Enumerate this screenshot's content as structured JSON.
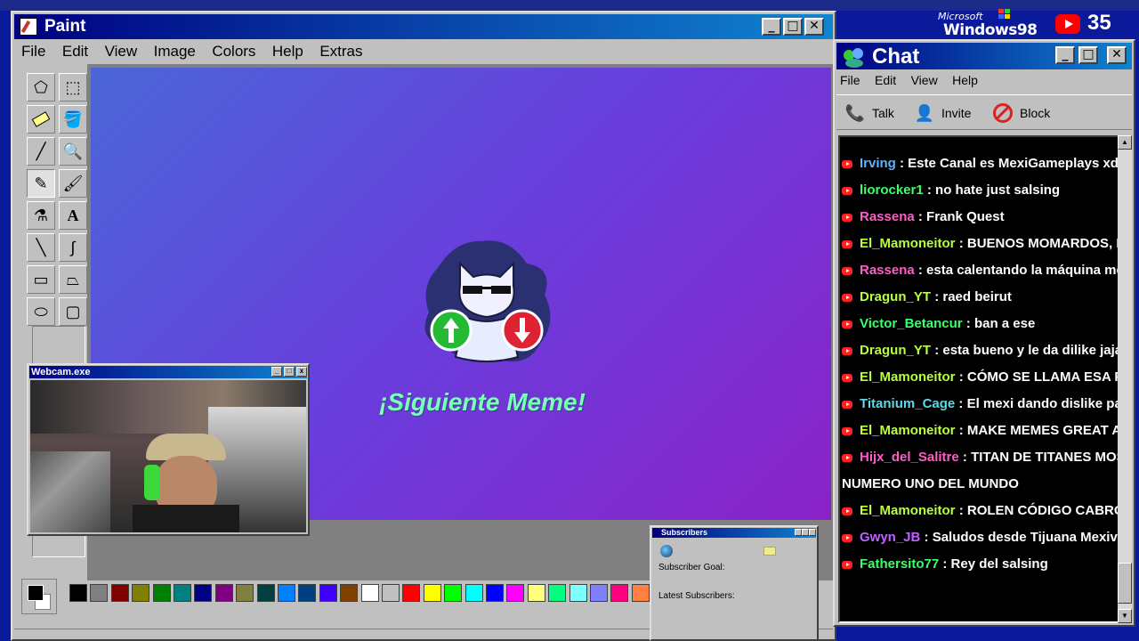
{
  "desktop": {
    "windows_badge_top": "Microsoft",
    "windows_badge_main": "Windows98",
    "youtube_count": "35"
  },
  "paint": {
    "title": "Paint",
    "menu": [
      "File",
      "Edit",
      "View",
      "Image",
      "Colors",
      "Help",
      "Extras"
    ],
    "canvas_text": "¡Siguiente Meme!",
    "tools": [
      "free-select-icon",
      "select-icon",
      "eraser-icon",
      "fill-icon",
      "picker-icon",
      "magnifier-icon",
      "pencil-icon",
      "brush-icon",
      "airbrush-icon",
      "text-icon",
      "line-icon",
      "curve-icon",
      "rectangle-icon",
      "polygon-icon",
      "ellipse-icon",
      "rounded-rect-icon"
    ],
    "palette": [
      "#000000",
      "#808080",
      "#800000",
      "#808000",
      "#008000",
      "#008080",
      "#000080",
      "#800080",
      "#808040",
      "#004040",
      "#0080ff",
      "#004080",
      "#4000ff",
      "#804000",
      "#ffffff",
      "#c0c0c0",
      "#ff0000",
      "#ffff00",
      "#00ff00",
      "#00ffff",
      "#0000ff",
      "#ff00ff",
      "#ffff80",
      "#00ff80",
      "#80ffff",
      "#8080ff",
      "#ff0080",
      "#ff8040"
    ]
  },
  "webcam": {
    "title": "Webcam.exe"
  },
  "subscribers": {
    "title": "Subscribers",
    "goal_label": "Subscriber Goal:",
    "latest_label": "Latest Subscribers:"
  },
  "chat": {
    "title": "Chat",
    "menu": [
      "File",
      "Edit",
      "View",
      "Help"
    ],
    "toolbar": {
      "talk": "Talk",
      "invite": "Invite",
      "block": "Block"
    },
    "messages": [
      {
        "user": "Irving",
        "color": "#5fb4ff",
        "text": ": Este Canal es MexiGameplays xd"
      },
      {
        "user": "liorocker1",
        "color": "#3cff6a",
        "text": ": no hate just salsing"
      },
      {
        "user": "Rassena",
        "color": "#ff5cc8",
        "text": ": Frank Quest"
      },
      {
        "user": "El_Mamoneitor",
        "color": "#b8ff3c",
        "text": ": BUENOS MOMARDOS, BA"
      },
      {
        "user": "Rassena",
        "color": "#ff5cc8",
        "text": ": esta calentando la máquina mem"
      },
      {
        "user": "Dragun_YT",
        "color": "#b8ff3c",
        "text": ": raed beirut"
      },
      {
        "user": "Victor_Betancur",
        "color": "#3cff6a",
        "text": ": ban a ese"
      },
      {
        "user": "Dragun_YT",
        "color": "#b8ff3c",
        "text": ": esta bueno y le da dilike jaja"
      },
      {
        "user": "El_Mamoneitor",
        "color": "#b8ff3c",
        "text": ": CÓMO SE LLAMA ESA PÁ"
      },
      {
        "user": "Titanium_Cage",
        "color": "#5fd8e8",
        "text": ": El mexi dando dislike para"
      },
      {
        "user": "El_Mamoneitor",
        "color": "#b8ff3c",
        "text": ": MAKE MEMES GREAT AGA"
      },
      {
        "user": "Hijx_del_Salitre",
        "color": "#ff5cc8",
        "text": ": TITAN DE TITANES MOST"
      },
      {
        "user": "",
        "color": "#ffffff",
        "text": "NUMERO UNO DEL MUNDO"
      },
      {
        "user": "El_Mamoneitor",
        "color": "#b8ff3c",
        "text": ": ROLEN CÓDIGO CABRONE"
      },
      {
        "user": "Gwyn_JB",
        "color": "#c060ff",
        "text": ": Saludos desde Tijuana Mexiver g"
      },
      {
        "user": "Fathersito77",
        "color": "#3cff6a",
        "text": ": Rey del salsing"
      }
    ]
  }
}
